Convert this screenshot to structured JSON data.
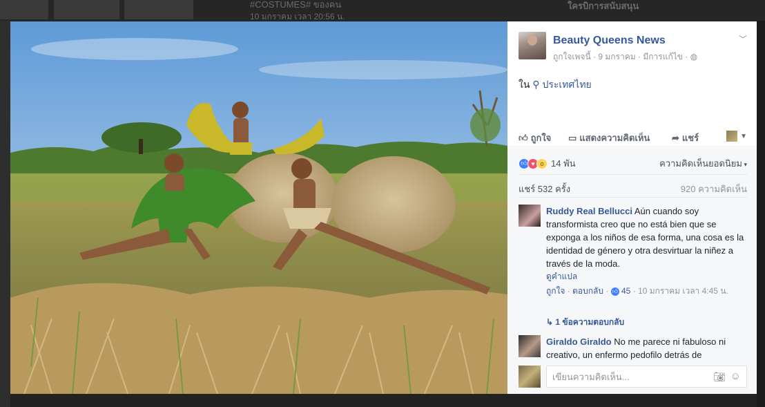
{
  "background": {
    "top_title": "#COSTUMES# ของคน",
    "top_date": "10 มกราคม เวลา 20:56 น.",
    "top_right": "ใครบิการสนับสนุน"
  },
  "photo": {
    "alt": "Children in grass and straw costumes in a harvested rice field"
  },
  "post": {
    "page_name": "Beauty Queens News",
    "like_page": "ถูกใจเพจนี้",
    "date": "9 มกราคม",
    "edited": "มีการแก้ไข",
    "location_prefix": "ใน",
    "location": "ประเทศไทย"
  },
  "actions": {
    "like": "ถูกใจ",
    "comment": "แสดงความคิดเห็น",
    "share": "แชร์"
  },
  "stats": {
    "reaction_count": "14 พัน",
    "sort_label": "ความคิดเห็นยอดนิยม",
    "shares": "แชร์ 532 ครั้ง",
    "comments": "920 ความคิดเห็น"
  },
  "comments": [
    {
      "name": "Ruddy Real Bellucci",
      "text": "Aún cuando soy transformista creo que no está bien que se exponga a los niños de esa forma, una cosa es la identidad de género y otra desvirtuar la niñez a través de la moda.",
      "translate": "ดูคำแปล",
      "like": "ถูกใจ",
      "reply": "ตอบกลับ",
      "likes": "45",
      "time": "10 มกราคม เวลา 4:45 น.",
      "replies": "1 ข้อความตอบกลับ"
    },
    {
      "name": "Giraldo Giraldo",
      "text": "No me parece ni fabuloso ni creativo, un enfermo pedofilo detrás de"
    }
  ],
  "composer": {
    "placeholder": "เขียนความคิดเห็น..."
  },
  "colors": {
    "link": "#365899",
    "like_blue": "#4080ff",
    "love_red": "#f25268",
    "wow_yellow": "#fcd354"
  }
}
